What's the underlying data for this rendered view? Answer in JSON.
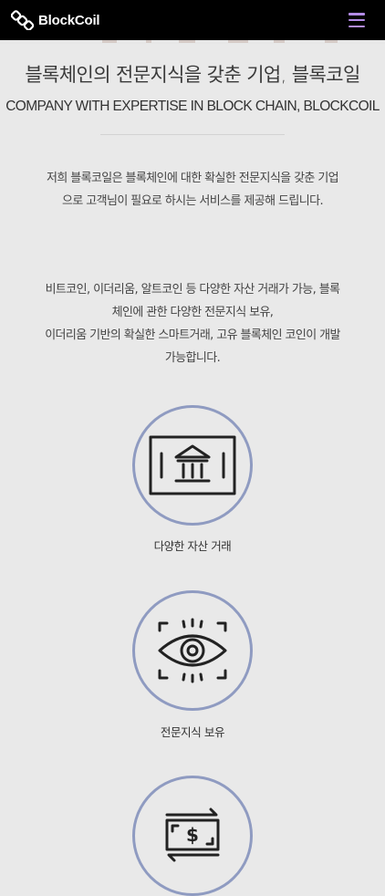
{
  "header": {
    "logo_text": "BlockCoil",
    "menu_icon": "hamburger-menu-icon",
    "accent_color": "#b38be6"
  },
  "intro": {
    "title": "블록체인의 전문지식을 갖춘 기업, 블록코일",
    "subtitle": "COMPANY WITH EXPERTISE IN BLOCK CHAIN, BLOCKCOIL",
    "paragraph1": "저희 블록코일은 블록체인에 대한 확실한 전문지식을 갖춘 기업으로 고객님이 필요로 하시는 서비스를 제공해 드립니다.",
    "paragraph2_lines": [
      "비트코인, 이더리움, 알트코인 등 다양한 자산 거래가 가능, 블록체인에 관한 다양한 전문지식 보유,",
      "이더리움 기반의 확실한 스마트거래, 고유 블록체인 코인이 개발가능합니다."
    ]
  },
  "features": [
    {
      "label": "다양한 자산 거래",
      "icon": "bank-icon"
    },
    {
      "label": "전문지식 보유",
      "icon": "eye-icon"
    },
    {
      "label": "",
      "icon": "money-transfer-icon"
    }
  ],
  "colors": {
    "circle_border": "#8f9bc1",
    "background": "#e9e9e9",
    "header_bg": "#000000"
  }
}
